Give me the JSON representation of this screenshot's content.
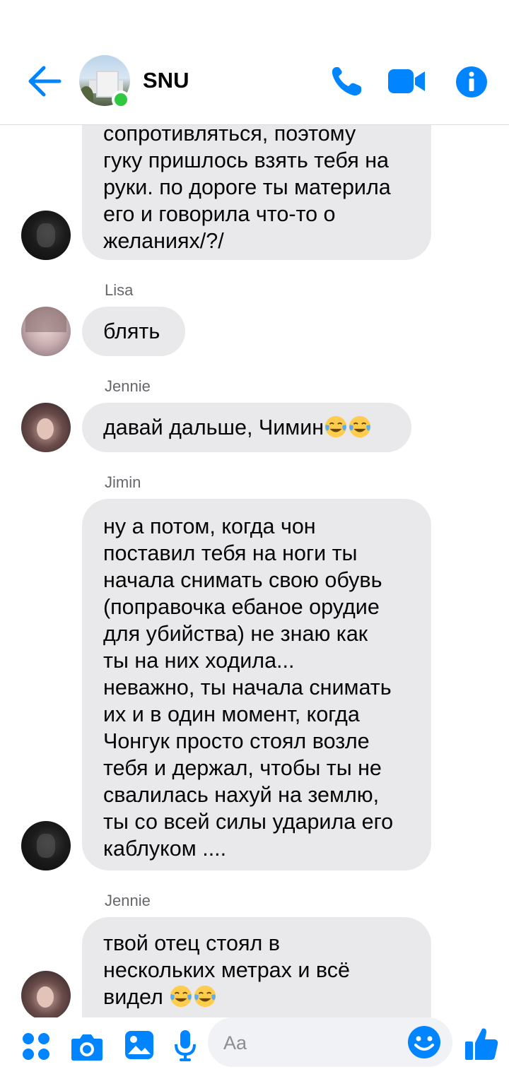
{
  "header": {
    "title": "SNU",
    "online": true
  },
  "colors": {
    "accent": "#0084ff",
    "bubble": "#e9e9eb",
    "online": "#31c740"
  },
  "messages": [
    {
      "sender": "",
      "lines": [
        "сопротивляться, поэтому",
        "гуку пришлось взять тебя на",
        "руки. по дороге ты материла",
        "его и говорила что-то о",
        "желаниях/?/"
      ]
    },
    {
      "sender": "Lisa",
      "lines": [
        "блять"
      ]
    },
    {
      "sender": "Jennie",
      "lines": [
        "давай дальше, Чимин"
      ],
      "emoji": [
        "face-with-tears-of-joy",
        "face-with-tears-of-joy"
      ]
    },
    {
      "sender": "Jimin",
      "lines": [
        "ну а потом, когда чон",
        "поставил тебя на ноги ты",
        "начала снимать свою обувь",
        "(поправочка ебаное орудие",
        "для убийства) не знаю как",
        "ты на них ходила...",
        "неважно, ты начала снимать",
        "их и в один момент, когда",
        "Чонгук просто стоял возле",
        "тебя и держал, чтобы ты не",
        "свалилась нахуй на землю,",
        "ты со всей силы ударила его",
        "каблуком ...."
      ]
    },
    {
      "sender": "Jennie",
      "lines": [
        "твой отец стоял в",
        "нескольких метрах и всё",
        "видел"
      ],
      "emoji": [
        "face-with-tears-of-joy",
        "face-with-tears-of-joy"
      ]
    }
  ],
  "composer": {
    "placeholder": "Aa"
  },
  "icons": {
    "header": [
      "back-arrow-icon",
      "phone-icon",
      "video-camera-icon",
      "info-icon"
    ],
    "composer": [
      "apps-grid-icon",
      "camera-icon",
      "gallery-icon",
      "microphone-icon",
      "emoji-icon",
      "thumbs-up-icon"
    ]
  }
}
